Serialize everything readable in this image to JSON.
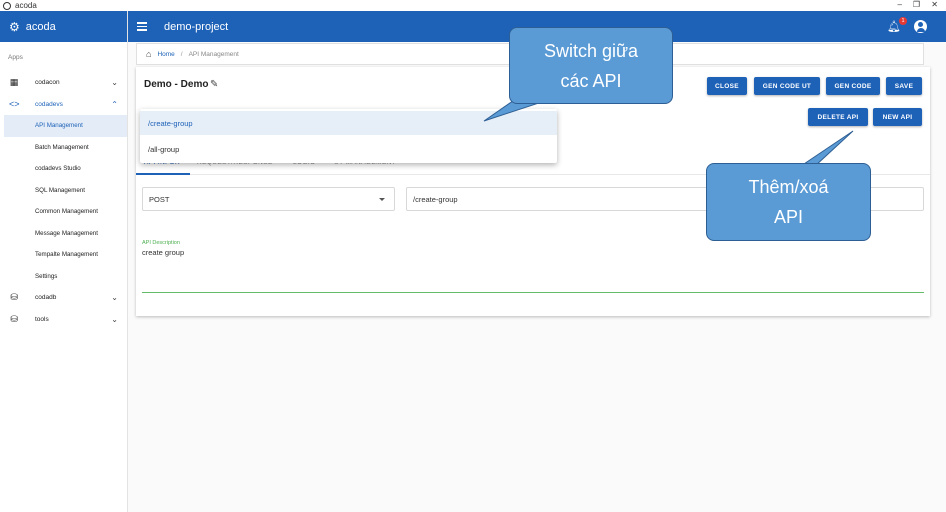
{
  "window": {
    "title": "acoda",
    "controls": [
      "–",
      "❐",
      "✕"
    ]
  },
  "sidebar": {
    "brand": "acoda",
    "section_label": "Apps",
    "groups": [
      {
        "label": "codacon",
        "icon": "grid-icon"
      },
      {
        "label": "codadevs",
        "icon": "code-icon"
      },
      {
        "label": "codadb",
        "icon": "database-icon"
      },
      {
        "label": "tools",
        "icon": "database-icon"
      }
    ],
    "codadevs_items": [
      "API Management",
      "Batch Management",
      "codadevs Studio",
      "SQL Management",
      "Common Management",
      "Message Management",
      "Tempalte Management",
      "Settings"
    ]
  },
  "header": {
    "project": "demo-project",
    "notification_count": "1"
  },
  "breadcrumb": {
    "home": "Home",
    "separator": "/",
    "current": "API Management"
  },
  "api": {
    "title": "Demo - Demo"
  },
  "buttons": {
    "close": "CLOSE",
    "gen_code_ut": "GEN CODE UT",
    "gen_code": "GEN CODE",
    "save": "SAVE",
    "delete_api": "DELETE API",
    "new_api": "NEW API"
  },
  "tabs": [
    "API INFOR",
    "REQUEST/RESPONSE",
    "LOGIC",
    "UT MANAGEMENT"
  ],
  "form": {
    "method": "POST",
    "path": "/create-group",
    "description_label": "API Description",
    "description": "create group"
  },
  "dropdown": {
    "options": [
      "/create-group",
      "/all-group"
    ],
    "selected": "/create-group"
  },
  "callouts": {
    "switch": [
      "Switch giữa",
      "các API"
    ],
    "add_remove": [
      "Thêm/xoá",
      "API"
    ]
  },
  "colors": {
    "primary": "#1e62b8",
    "callout": "#5b9bd5",
    "success": "#4caf50"
  }
}
